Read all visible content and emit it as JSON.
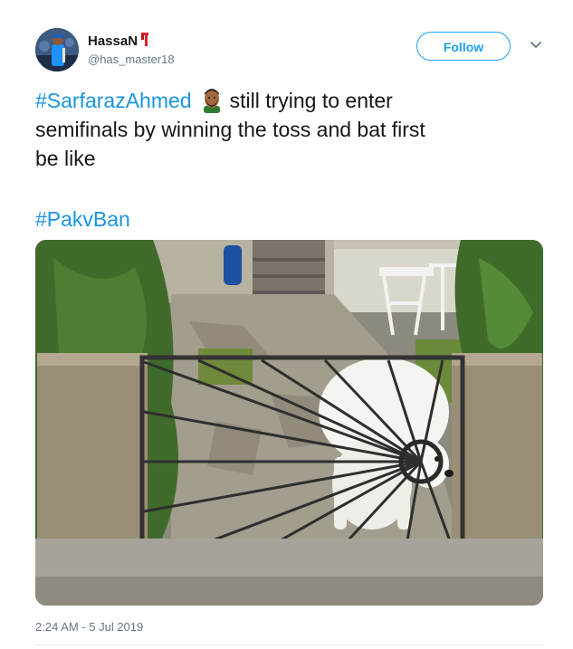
{
  "user": {
    "display_name": "HassaN",
    "handle": "@has_master18",
    "avatar_icon": "cricket-player-avatar",
    "name_emoji": "red-scarf-emoji"
  },
  "follow_button": {
    "label": "Follow"
  },
  "menu": {
    "icon": "chevron-down-icon"
  },
  "tweet": {
    "hashtag_1": "#SarfarazAhmed",
    "emoji": "bearded-man-emoji",
    "text_line_1": "still trying to enter",
    "text_line_2": "semifinals by winning  the toss and bat first",
    "text_line_3": "be like",
    "hashtag_2": "#PakvBan"
  },
  "media": {
    "description_icon": "dog-stuck-in-gate-photo"
  },
  "meta": {
    "timestamp": "2:24 AM - 5 Jul 2019"
  },
  "colors": {
    "link": "#1b95e0",
    "follow": "#1da1f2",
    "muted": "#657786"
  }
}
